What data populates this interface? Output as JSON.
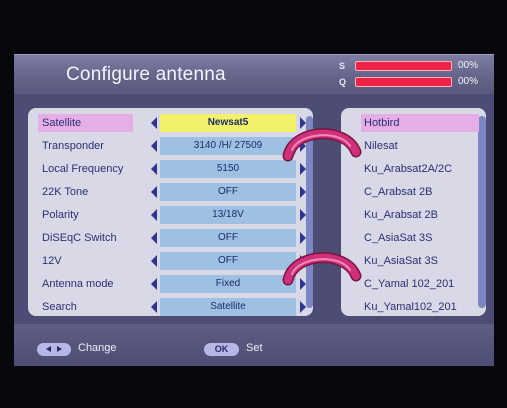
{
  "header": {
    "title": "Configure antenna",
    "signal": {
      "s_label": "S",
      "s_value": "00%",
      "q_label": "Q",
      "q_value": "00%"
    }
  },
  "settings": [
    {
      "label": "Satellite",
      "value": "Newsat5",
      "selected": true
    },
    {
      "label": "Transponder",
      "value": "3140 /H/ 27509"
    },
    {
      "label": "Local Frequency",
      "value": "5150"
    },
    {
      "label": "22K Tone",
      "value": "OFF"
    },
    {
      "label": "Polarity",
      "value": "13/18V"
    },
    {
      "label": "DiSEqC Switch",
      "value": "OFF"
    },
    {
      "label": "12V",
      "value": "OFF"
    },
    {
      "label": "Antenna mode",
      "value": "Fixed"
    },
    {
      "label": "Search",
      "value": "Satellite"
    }
  ],
  "satellites": [
    "Hotbird",
    "Nilesat",
    "Ku_Arabsat2A/2C",
    "C_Arabsat 2B",
    "Ku_Arabsat 2B",
    "C_AsiaSat 3S",
    "Ku_AsiaSat 3S",
    "C_Yamal 102_201",
    "Ku_Yamal102_201"
  ],
  "footer": {
    "change_key": "",
    "change_label": "Change",
    "ok_key": "OK",
    "set_label": "Set"
  },
  "colors": {
    "accent_hook": "#d0307a",
    "value_bg": "#9ec1e3",
    "selected_value_bg": "#f2f26a",
    "selected_label_bg": "#e6aee6"
  }
}
